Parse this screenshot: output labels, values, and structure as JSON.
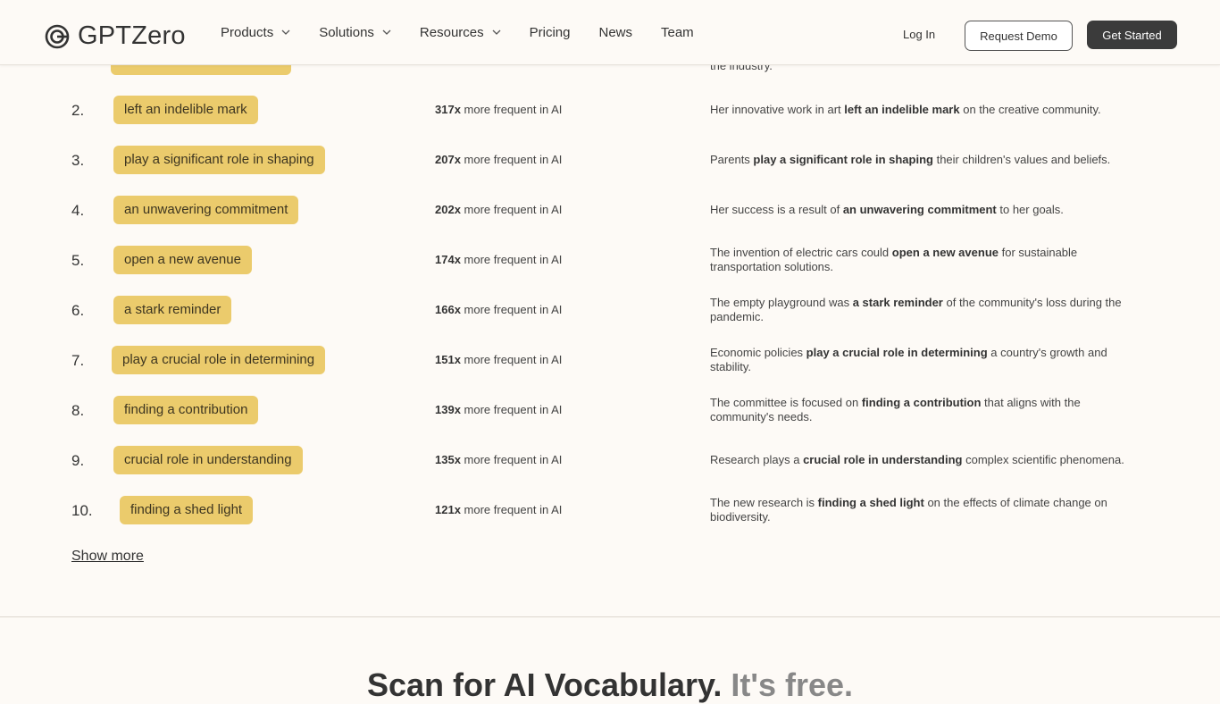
{
  "header": {
    "logo_text": "GPTZero",
    "nav": [
      {
        "label": "Products",
        "dropdown": true
      },
      {
        "label": "Solutions",
        "dropdown": true
      },
      {
        "label": "Resources",
        "dropdown": true
      },
      {
        "label": "Pricing",
        "dropdown": false
      },
      {
        "label": "News",
        "dropdown": false
      },
      {
        "label": "Team",
        "dropdown": false
      }
    ],
    "login_label": "Log In",
    "demo_label": "Request Demo",
    "start_label": "Get Started"
  },
  "partial_row": {
    "example_tail": "the industry."
  },
  "rows": [
    {
      "num": "2.",
      "phrase": "left an indelible mark",
      "freq": "317x",
      "freq_suffix": "more frequent in AI",
      "ex_pre": "Her innovative work in art ",
      "ex_bold": "left an indelible mark",
      "ex_post": " on the creative community."
    },
    {
      "num": "3.",
      "phrase": "play a significant role in shaping",
      "freq": "207x",
      "freq_suffix": "more frequent in AI",
      "ex_pre": "Parents ",
      "ex_bold": "play a significant role in shaping",
      "ex_post": " their children's values and beliefs."
    },
    {
      "num": "4.",
      "phrase": "an unwavering commitment",
      "freq": "202x",
      "freq_suffix": "more frequent in AI",
      "ex_pre": "Her success is a result of ",
      "ex_bold": "an unwavering commitment",
      "ex_post": " to her goals."
    },
    {
      "num": "5.",
      "phrase": "open a new avenue",
      "freq": "174x",
      "freq_suffix": "more frequent in AI",
      "ex_pre": "The invention of electric cars could ",
      "ex_bold": "open a new avenue",
      "ex_post": " for sustainable transportation solutions."
    },
    {
      "num": "6.",
      "phrase": "a stark reminder",
      "freq": "166x",
      "freq_suffix": "more frequent in AI",
      "ex_pre": "The empty playground was ",
      "ex_bold": "a stark reminder",
      "ex_post": " of the community's loss during the pandemic."
    },
    {
      "num": "7.",
      "phrase": "play a crucial role in determining",
      "freq": "151x",
      "freq_suffix": "more frequent in AI",
      "ex_pre": "Economic policies ",
      "ex_bold": "play a crucial role in determining",
      "ex_post": " a country's growth and stability."
    },
    {
      "num": "8.",
      "phrase": "finding a contribution",
      "freq": "139x",
      "freq_suffix": "more frequent in AI",
      "ex_pre": "The committee is focused on ",
      "ex_bold": "finding a contribution",
      "ex_post": " that aligns with the community's needs."
    },
    {
      "num": "9.",
      "phrase": "crucial role in understanding",
      "freq": "135x",
      "freq_suffix": "more frequent in AI",
      "ex_pre": "Research plays a ",
      "ex_bold": "crucial role in understanding",
      "ex_post": " complex scientific phenomena."
    },
    {
      "num": "10.",
      "phrase": "finding a shed light",
      "freq": "121x",
      "freq_suffix": "more frequent in AI",
      "ex_pre": "The new research is ",
      "ex_bold": "finding a shed light",
      "ex_post": " on the effects of climate change on biodiversity."
    }
  ],
  "show_more_label": "Show more",
  "scan": {
    "heading_main": "Scan for AI Vocabulary.",
    "heading_muted": "It's free."
  },
  "colors": {
    "background": "#fdfaf6",
    "pill": "#ebcb6c",
    "primary_button": "#3b3b3b"
  }
}
